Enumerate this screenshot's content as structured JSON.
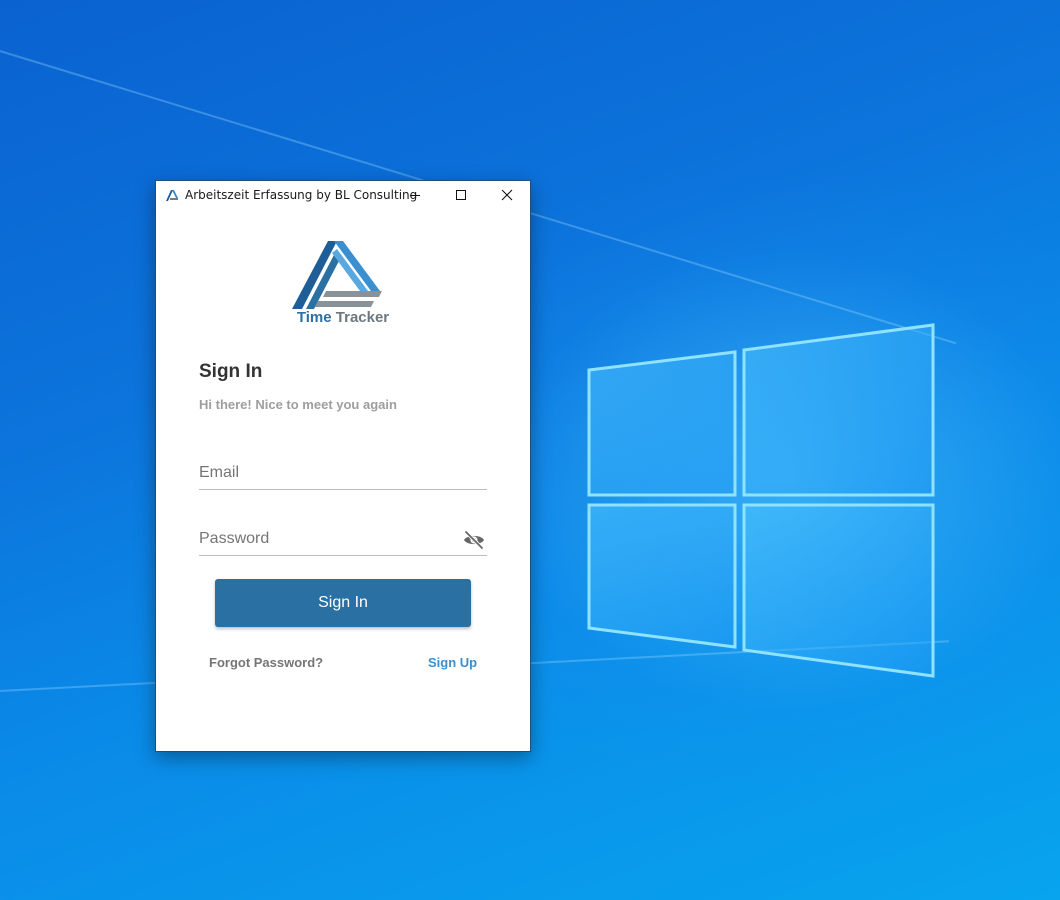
{
  "window": {
    "title": "Arbeitszeit Erfassung by BL Consulting",
    "controls": {
      "minimize_icon": "minimize-icon",
      "maximize_icon": "maximize-icon",
      "close_icon": "close-icon"
    }
  },
  "logo": {
    "word1": "Time",
    "word2": "Tracker"
  },
  "login": {
    "heading": "Sign In",
    "subheading": "Hi there! Nice to meet you again",
    "email": {
      "value": "",
      "placeholder": "Email"
    },
    "password": {
      "value": "",
      "placeholder": "Password",
      "toggle_icon": "eye-off-icon"
    },
    "submit_label": "Sign In",
    "forgot_label": "Forgot Password?",
    "signup_label": "Sign Up"
  },
  "colors": {
    "primary": "#2a70a2",
    "link": "#3a8fd0",
    "desktop": "#0a74dc"
  }
}
